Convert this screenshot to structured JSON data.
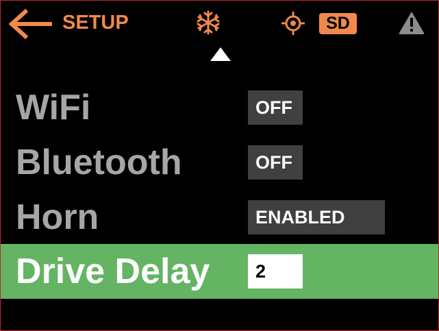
{
  "header": {
    "back_label": "SETUP",
    "back_icon": "arrow-left-icon",
    "mode_icon": "snowflake-icon",
    "location_icon": "crosshair-icon",
    "sd_badge": "SD",
    "warning_icon": "warning-triangle-icon",
    "scroll_up_icon": "triangle-up-icon"
  },
  "settings": [
    {
      "label": "WiFi",
      "value": "OFF",
      "selected": false
    },
    {
      "label": "Bluetooth",
      "value": "OFF",
      "selected": false
    },
    {
      "label": "Horn",
      "value": "ENABLED",
      "selected": false
    },
    {
      "label": "Drive Delay",
      "value": "2",
      "selected": true
    }
  ],
  "colors": {
    "accent": "#f08a4b",
    "selected_row": "#64b463",
    "label_gray": "#a6a6a6",
    "value_box": "#404040",
    "background": "#000000",
    "border": "#c0252a"
  }
}
